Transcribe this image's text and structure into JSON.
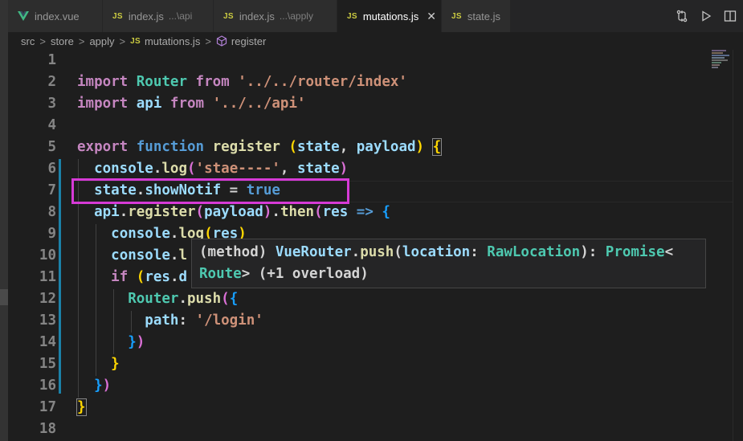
{
  "tabs": [
    {
      "label": "index.vue",
      "description": "",
      "icon": "vue-icon",
      "active": false
    },
    {
      "label": "index.js",
      "description": "...\\api",
      "icon": "js-icon",
      "active": false
    },
    {
      "label": "index.js",
      "description": "...\\apply",
      "icon": "js-icon",
      "active": false
    },
    {
      "label": "mutations.js",
      "description": "",
      "icon": "js-icon",
      "active": true
    },
    {
      "label": "state.js",
      "description": "",
      "icon": "js-icon",
      "active": false
    }
  ],
  "js_badge": "JS",
  "close_glyph": "✕",
  "tab_actions": [
    "source-control-compare-icon",
    "run-icon",
    "split-editor-icon"
  ],
  "breadcrumb": {
    "segments": [
      "src",
      "store",
      "apply",
      "mutations.js",
      "register"
    ],
    "separator": ">"
  },
  "editor": {
    "line_numbers": [
      "1",
      "2",
      "3",
      "4",
      "5",
      "6",
      "7",
      "8",
      "9",
      "10",
      "11",
      "12",
      "13",
      "14",
      "15",
      "16",
      "17",
      "18"
    ]
  },
  "hover": {
    "line1": [
      "(method) ",
      "VueRouter",
      ".",
      "push",
      "(",
      "location",
      ": ",
      "RawLocation",
      "): ",
      "Promise",
      "<"
    ],
    "line2": [
      "Route",
      "> (+1 overload)"
    ]
  },
  "colors": {
    "highlight_box": "#d63ad6",
    "background": "#1e1e1e",
    "keyword": "#c586c0",
    "string": "#ce9178",
    "function": "#dcdcaa",
    "variable": "#9cdcfe",
    "type": "#4ec9b0"
  }
}
